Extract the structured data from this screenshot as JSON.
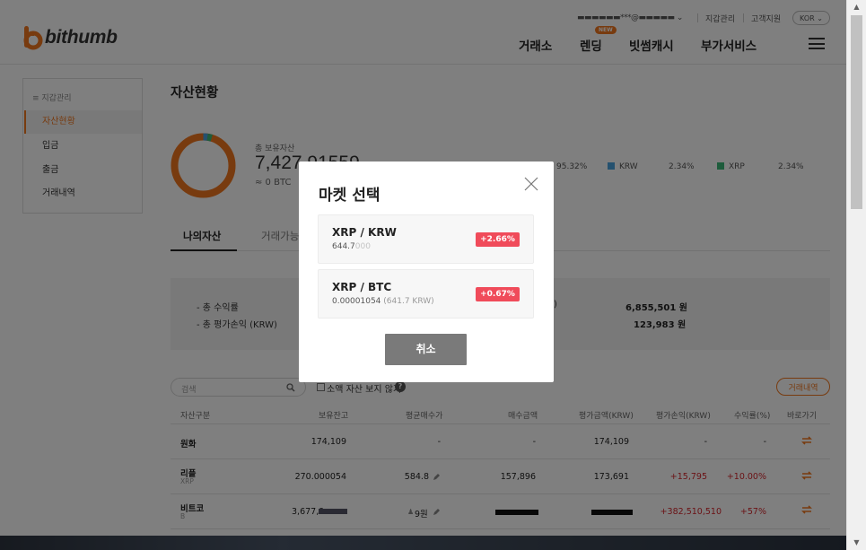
{
  "header": {
    "logo_text": "bithumb",
    "account_masked": "▬▬▬▬▬▬***@▬▬▬▬▬ ⌄",
    "wallet_link": "지갑관리",
    "support_link": "고객지원",
    "language": "KOR ⌄",
    "nav": [
      "거래소",
      "렌딩",
      "빗썸캐시",
      "부가서비스"
    ],
    "new_badge": "NEW"
  },
  "sidebar": {
    "heading": "≡ 지갑관리",
    "items": [
      "자산현황",
      "입금",
      "출금",
      "거래내역"
    ]
  },
  "page_title": "자산현황",
  "assets": {
    "total_label": "총 보유자산",
    "total_value": "7,427,91559",
    "total_btc": "≈ 0 BTC",
    "legend": [
      {
        "label": "",
        "percent": "95.32%",
        "color": "#f0761f"
      },
      {
        "label": "KRW",
        "percent": "2.34%",
        "color": "#4aa3df"
      },
      {
        "label": "XRP",
        "percent": "2.34%",
        "color": "#3cb878"
      }
    ],
    "donut_shares": [
      95.32,
      2.34,
      2.34
    ]
  },
  "tabs": [
    "나의자산",
    "거래가능"
  ],
  "summary": {
    "row1_label": "- 총 수익률",
    "row2_label": "- 총 평가손익 (KRW)",
    "paren": ")",
    "row1_value": "6,855,501 원",
    "row2_value": "123,983 원"
  },
  "filters": {
    "search_placeholder": "검색",
    "hide_small_label": "소액 자산 보지 않기",
    "help": "?",
    "history_button": "거래내역"
  },
  "table": {
    "headers": [
      "자산구분",
      "보유잔고",
      "평균매수가",
      "매수금액",
      "평가금액(KRW)",
      "평가손익(KRW)",
      "수익률(%)",
      "바로가기"
    ],
    "rows": [
      {
        "name": "원화",
        "sub": "",
        "balance": "174,109",
        "avg": "-",
        "buy": "-",
        "eval": "174,109",
        "pnl": "-",
        "rate": "-"
      },
      {
        "name": "리플",
        "sub": "XRP",
        "balance": "270.000054",
        "avg": "584.8",
        "buy": "157,896",
        "eval": "173,691",
        "pnl": "+15,795",
        "rate": "+10.00%"
      },
      {
        "name": "비트코",
        "sub": "B",
        "balance": "3,677,9",
        "avg": "9원",
        "buy": "",
        "eval": "",
        "pnl": "+382,510,510",
        "rate": "+57%"
      }
    ]
  },
  "modal": {
    "title": "마켓 선택",
    "markets": [
      {
        "pair": "XRP / KRW",
        "price": "644.7",
        "price_dim": "000",
        "change": "+2.66%"
      },
      {
        "pair": "XRP / BTC",
        "price": "0.00001054",
        "price_dim": "(641.7 KRW)",
        "change": "+0.67%"
      }
    ],
    "cancel": "취소"
  }
}
